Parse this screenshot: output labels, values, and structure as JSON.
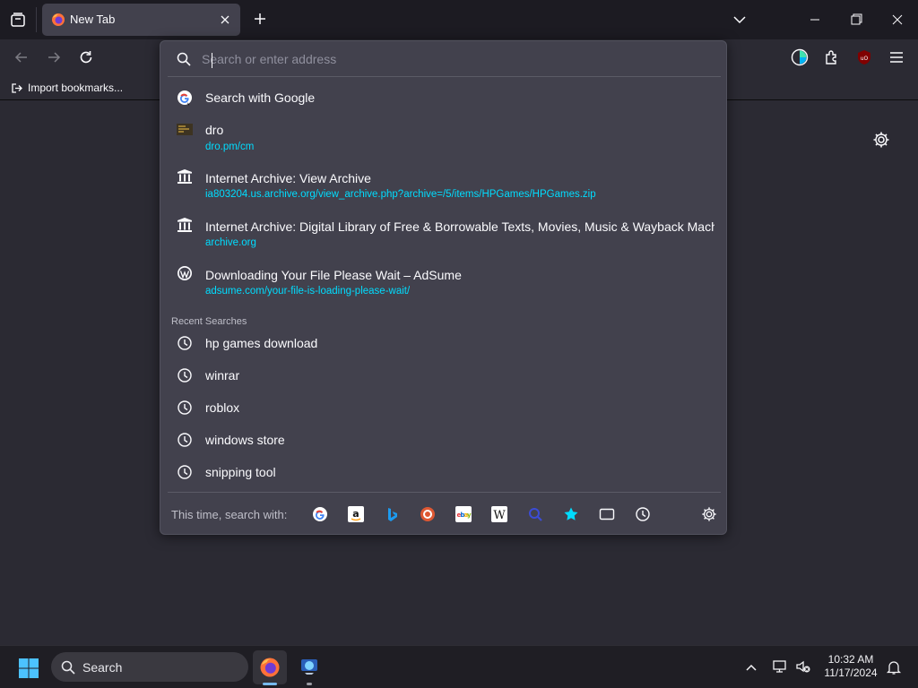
{
  "tab": {
    "title": "New Tab"
  },
  "bookmarks": {
    "import_label": "Import bookmarks..."
  },
  "urlbar": {
    "placeholder": "Search or enter address"
  },
  "search_with_google": "Search with Google",
  "results": [
    {
      "title": "dro",
      "url": "dro.pm/cm",
      "icon": "dro-favicon"
    },
    {
      "title": "Internet Archive: View Archive",
      "url": "ia803204.us.archive.org/view_archive.php?archive=/5/items/HPGames/HPGames.zip",
      "icon": "archive-icon"
    },
    {
      "title": "Internet Archive: Digital Library of Free & Borrowable Texts, Movies, Music & Wayback Machine",
      "url": "archive.org",
      "icon": "archive-icon"
    },
    {
      "title": "Downloading Your File Please Wait – AdSume",
      "url": "adsume.com/your-file-is-loading-please-wait/",
      "icon": "wordpress-icon"
    }
  ],
  "recent_searches_label": "Recent Searches",
  "recent_searches": [
    "hp games download",
    "winrar",
    "roblox",
    "windows store",
    "snipping tool"
  ],
  "one_off": {
    "label": "This time, search with:",
    "engines": [
      "google-icon",
      "amazon-icon",
      "bing-icon",
      "duckduckgo-icon",
      "ebay-icon",
      "wikipedia-icon",
      "search-engine-icon",
      "bookmarks-star-icon",
      "tabs-icon",
      "history-icon"
    ]
  },
  "taskbar": {
    "search_label": "Search",
    "time": "10:32 AM",
    "date": "11/17/2024"
  },
  "colors": {
    "url_accent": "#00ddff",
    "popup_bg": "#42414d",
    "page_bg": "#2b2a33",
    "chrome_bg": "#1c1b22"
  }
}
